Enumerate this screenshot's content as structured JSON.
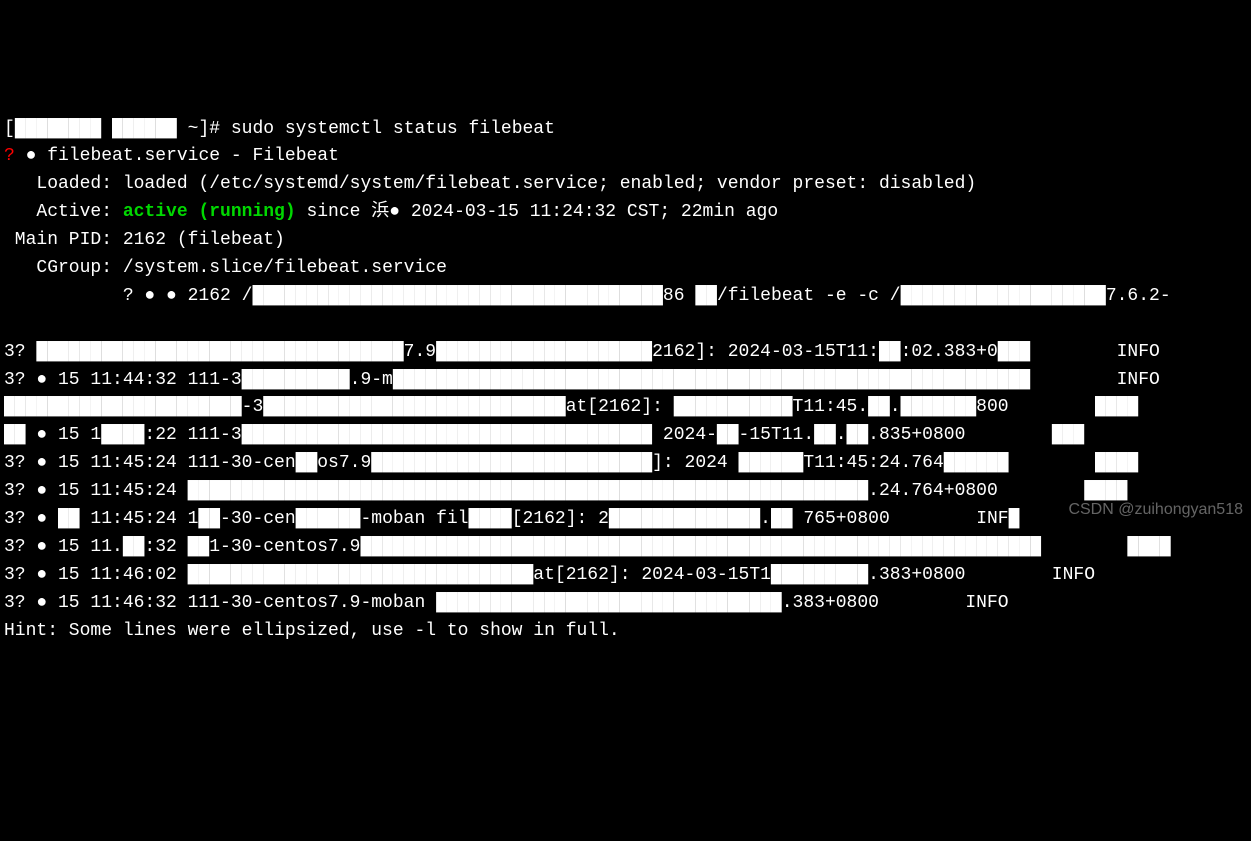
{
  "prompt": {
    "prefix": "[",
    "host_redacted": "████████ ██████",
    "suffix": " ~]# ",
    "command": "sudo systemctl status filebeat"
  },
  "service_header": {
    "bullet": "?",
    "icon": "●",
    "name": "filebeat.service",
    "sep": " - ",
    "desc": "Filebeat"
  },
  "loaded": {
    "label": "   Loaded: ",
    "value": "loaded (/etc/systemd/system/filebeat.service; enabled; vendor preset: disabled)"
  },
  "active": {
    "label": "   Active: ",
    "status": "active (running)",
    "since_prefix": " since",
    "since_rest": " 浜● 2024-03-15 11:24:32 CST; 22min ago"
  },
  "mainpid": {
    "label": " Main PID: ",
    "value": "2162 (filebeat)"
  },
  "cgroup": {
    "label": "   CGroup: ",
    "path": "/system.slice/filebeat.service"
  },
  "cgroup_sub": {
    "prefix": "           ? ● ● 2162 /",
    "mid": "██████████████████████████████████████86 ██",
    "t1": "/filebeat -e -c /",
    "mid2": "███████████████████",
    "t2": "7.6.2-"
  },
  "logs": [
    {
      "p": "3? ██████████████████████████████████",
      "m": "7.9████████████████████",
      "s": "2162]: 2024-03-15T11:██:02.383+0███",
      "pad": "        ",
      "lvl": "INFO"
    },
    {
      "p": "3? ● 15 11:44:32 111-3██████████",
      "m": ".9-m███████████████████████████",
      "s": "████████████████████████████████",
      "pad": "        ",
      "lvl": "INFO"
    },
    {
      "p": "██████████████████████-3█████████████",
      "m": "███████████████",
      "s": "at[2162]: ███████████T11:45.██.███████800",
      "pad": "        ",
      "lvl": "████"
    },
    {
      "p": "██ ● 15 1████:22 111-3████████████",
      "m": "██████████████████████████",
      "s": " 2024-██-15T11.██.██.835+0800",
      "pad": "        ",
      "lvl": "███"
    },
    {
      "p": "3? ● 15 11:45:24 111-30-cen██os7.9",
      "m": "████████████████████████",
      "s": "██]: 2024 ██████T11:45:24.764██████",
      "pad": "        ",
      "lvl": "████"
    },
    {
      "p": "3? ● 15 11:45:24 ██████████████",
      "m": "███████████████████████████████",
      "s": "██████████████████.24.764+0800",
      "pad": "        ",
      "lvl": "████"
    },
    {
      "p": "3? ● ██ 11:45:24 1██-30-cen██████",
      "m": "-moban fil████",
      "s": "[2162]: 2██████████████.██ 765+0800",
      "pad": "        ",
      "lvl": "INF█"
    },
    {
      "p": "3? ● 15 11.██:32 ██1-30-centos7.9",
      "m": "██████████████████████████████",
      "s": "█████████████████████████████████",
      "pad": "        ",
      "lvl": "████"
    },
    {
      "p": "3? ● 15 11:46:02 ████████████████",
      "m": "████████████████",
      "s": "at[2162]: 2024-03-15T1█████████.383+0800",
      "pad": "        ",
      "lvl": "INFO"
    },
    {
      "p": "3? ● 15 11:46:32 111-30-centos7.9-moban ",
      "m": "████████████████████████████████",
      "s": ".383+0800",
      "pad": "        ",
      "lvl": "INFO"
    }
  ],
  "hint": "Hint: Some lines were ellipsized, use -l to show in full.",
  "watermark": "CSDN @zuihongyan518"
}
